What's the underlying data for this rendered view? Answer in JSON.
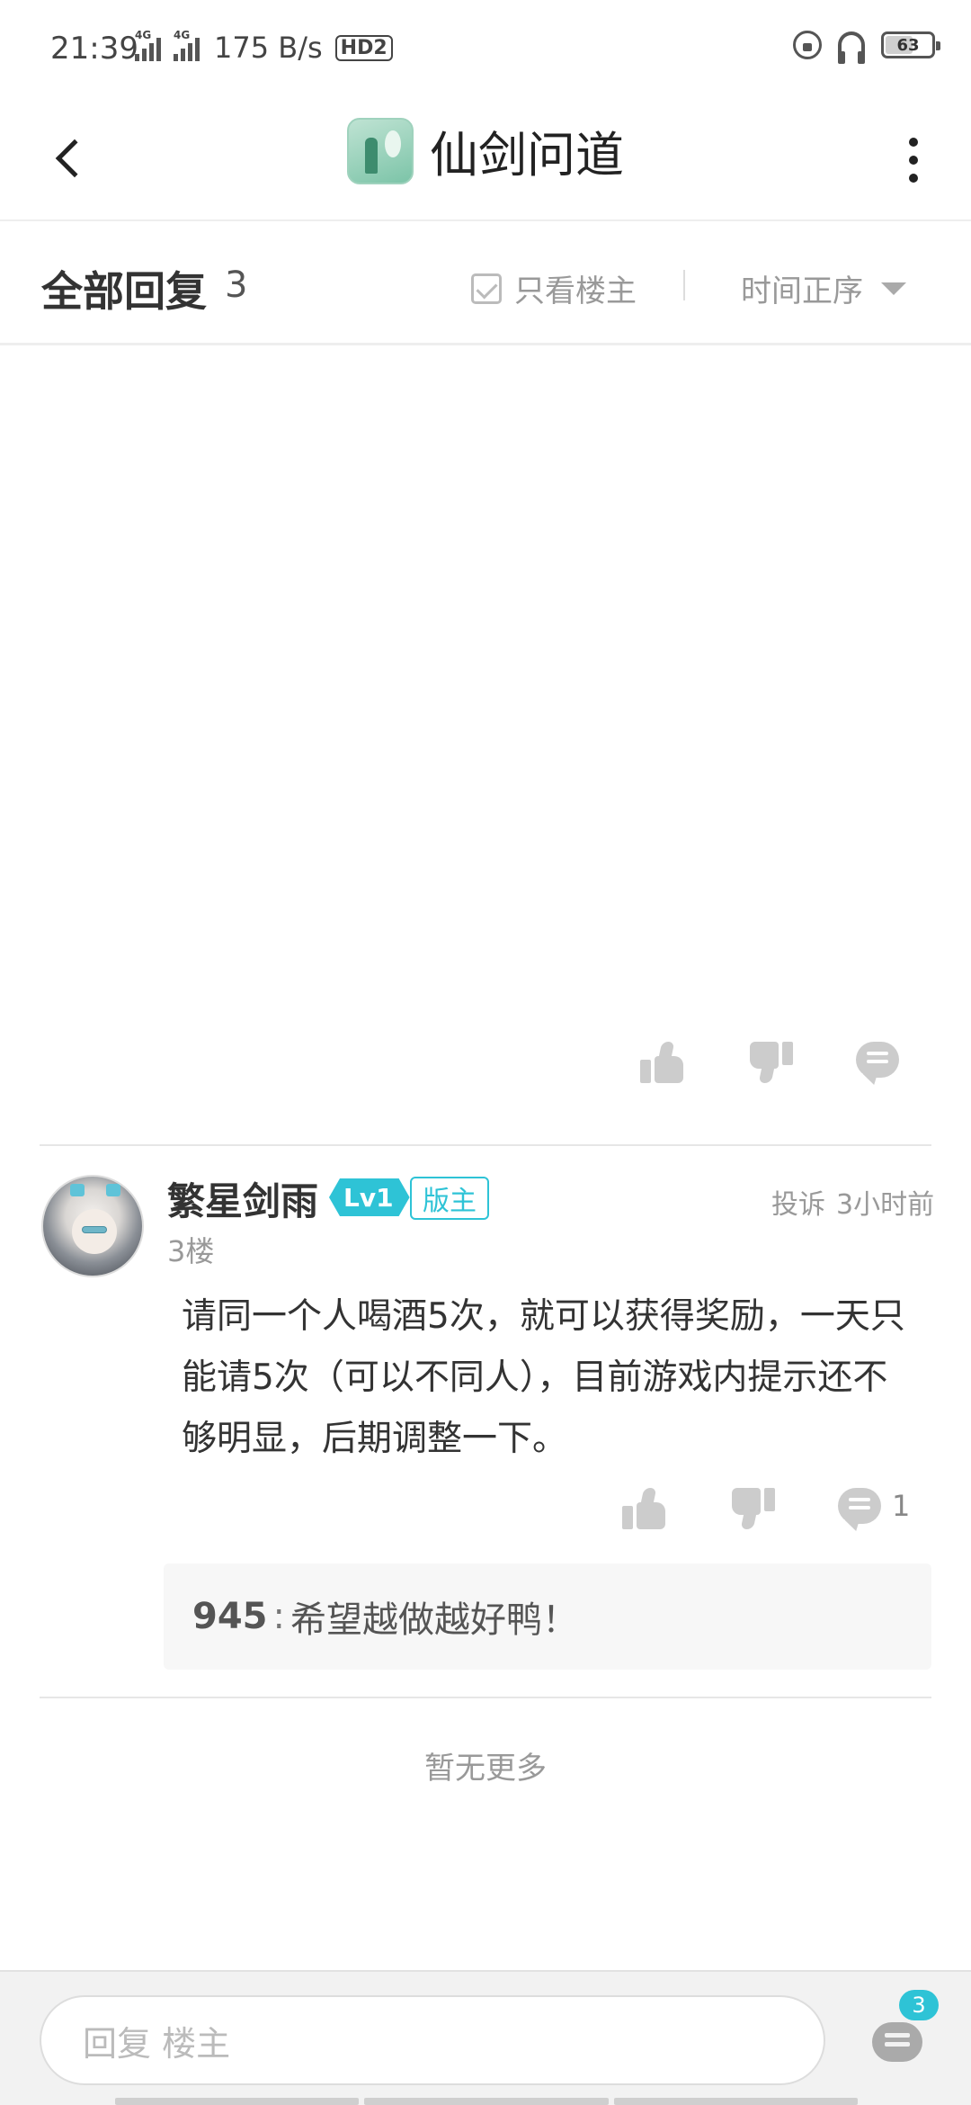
{
  "status_bar": {
    "time": "21:39",
    "network_1": "4G",
    "network_2": "4G",
    "speed": "175 B/s",
    "hd": "HD2",
    "battery": "63",
    "battery_level": 0.63
  },
  "header": {
    "title": "仙剑问道",
    "icons": {
      "back": "chevron-left-icon",
      "more": "more-vertical-icon",
      "app": "game-app-icon"
    }
  },
  "filter": {
    "label": "全部回复",
    "count": "3",
    "only_owner": "只看楼主",
    "sort": "时间正序"
  },
  "post": {
    "username": "繁星剑雨",
    "level": "Lv1",
    "role_badge": "版主",
    "report": "投诉",
    "time": "3小时前",
    "floor": "3楼",
    "content": "请同一个人喝酒5次，就可以获得奖励，一天只能请5次（可以不同人），目前游戏内提示还不够明显，后期调整一下。",
    "comment_count": "1",
    "sub_reply": {
      "user": "945",
      "separator": ":",
      "text": "希望越做越好鸭！"
    }
  },
  "footer_note": "暂无更多",
  "bottom": {
    "reply_placeholder": "回复  楼主",
    "comments_badge": "3"
  },
  "colors": {
    "accent": "#2ec3d6",
    "text": "#333333",
    "muted": "#999999",
    "icon_gray": "#cccccc"
  }
}
